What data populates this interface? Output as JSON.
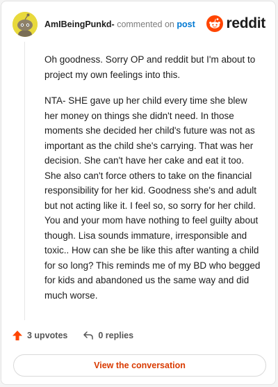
{
  "header": {
    "username": "AmIBeingPunkd-",
    "action_text": "commented on",
    "post_link": "post",
    "brand": "reddit"
  },
  "comment": {
    "paragraphs": [
      "Oh goodness. Sorry OP and reddit but I'm about to project my own feelings into this.",
      "NTA- SHE gave up her child every time she blew her money on things she didn't need. In those moments she decided her child's future was not as important as the child she's carrying. That was her decision. She can't have her cake and eat it too. She also can't force others to take on the financial responsibility for her kid. Goodness she's and adult but not acting like it. I feel so, so sorry for her child. You and your mom have nothing to feel guilty about though. Lisa sounds immature, irresponsible and toxic.. How can she be like this after wanting a child for so long? This reminds me of my BD who begged for kids and abandoned us the same way and did much worse."
    ]
  },
  "actions": {
    "upvotes": "3 upvotes",
    "replies": "0 replies"
  },
  "button": {
    "view_label": "View the conversation"
  },
  "colors": {
    "brand_orange": "#ff4500",
    "accent_link": "#0079d3",
    "button_text": "#d93a00",
    "avatar_bg": "#e8d93c"
  },
  "icons": {
    "avatar": "snoo-avatar",
    "logo": "reddit-logo-icon",
    "upvote": "upvote-arrow-icon",
    "reply": "reply-arrow-icon"
  }
}
